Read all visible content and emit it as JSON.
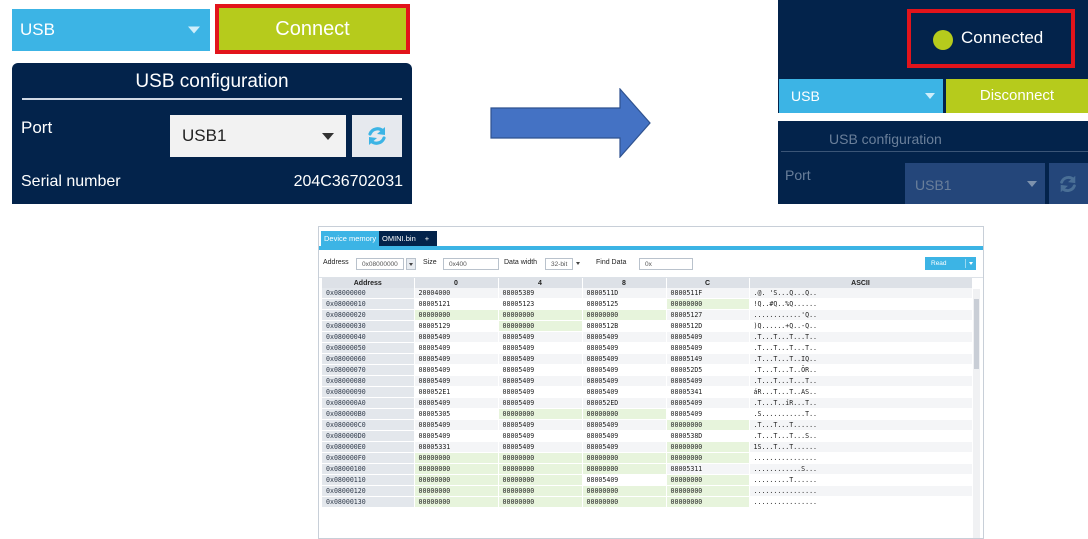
{
  "left_panel": {
    "interface": "USB",
    "connect_label": "Connect",
    "config_title": "USB configuration",
    "port_label": "Port",
    "port_value": "USB1",
    "serial_label": "Serial number",
    "serial_value": "204C36702031"
  },
  "right_panel": {
    "status": "Connected",
    "interface": "USB",
    "disconnect_label": "Disconnect",
    "config_title": "USB configuration",
    "port_label": "Port",
    "port_value": "USB1"
  },
  "colors": {
    "navy": "#03234b",
    "blue": "#3cb4e5",
    "green": "#b6cb1c",
    "highlight": "#e2141b",
    "arrow": "#4472c4"
  },
  "memory": {
    "tabs": [
      "Device memory",
      "OMINI.bin",
      "+"
    ],
    "toolbar": {
      "address_label": "Address",
      "address_value": "0x08000000",
      "size_label": "Size",
      "size_value": "0x400",
      "data_width_label": "Data width",
      "data_width_value": "32-bit",
      "find_label": "Find Data",
      "find_value": "0x",
      "read_label": "Read"
    },
    "columns": [
      "Address",
      "0",
      "4",
      "8",
      "C",
      "ASCII"
    ],
    "rows": [
      [
        "0x08000000",
        "20004000",
        "08005389",
        "0800511D",
        "0800511F",
        ".@. 'S...Q...Q.."
      ],
      [
        "0x08000010",
        "08005121",
        "08005123",
        "08005125",
        "00000000",
        "!Q..#Q..%Q......"
      ],
      [
        "0x08000020",
        "00000000",
        "00000000",
        "00000000",
        "08005127",
        "............'Q.."
      ],
      [
        "0x08000030",
        "08005129",
        "00000000",
        "0800512B",
        "0800512D",
        ")Q......+Q..-Q.."
      ],
      [
        "0x08000040",
        "08005409",
        "08005409",
        "08005409",
        "08005409",
        ".T...T...T...T.."
      ],
      [
        "0x08000050",
        "08005409",
        "08005409",
        "08005409",
        "08005409",
        ".T...T...T...T.."
      ],
      [
        "0x08000060",
        "08005409",
        "08005409",
        "08005409",
        "08005149",
        ".T...T...T..IQ.."
      ],
      [
        "0x08000070",
        "08005409",
        "08005409",
        "08005409",
        "080052D5",
        ".T...T...T..ÕR.."
      ],
      [
        "0x08000080",
        "08005409",
        "08005409",
        "08005409",
        "08005409",
        ".T...T...T...T.."
      ],
      [
        "0x08000090",
        "080052E1",
        "08005409",
        "08005409",
        "08005341",
        "áR...T...T..AS.."
      ],
      [
        "0x080000A0",
        "08005409",
        "08005409",
        "080052ED",
        "08005409",
        ".T...T..íR...T.."
      ],
      [
        "0x080000B0",
        "08005305",
        "00000000",
        "00000000",
        "08005409",
        ".S...........T.."
      ],
      [
        "0x080000C0",
        "08005409",
        "08005409",
        "08005409",
        "00000000",
        ".T...T...T......"
      ],
      [
        "0x080000D0",
        "08005409",
        "08005409",
        "08005409",
        "0800538D",
        ".T...T...T...S.."
      ],
      [
        "0x080000E0",
        "08005331",
        "08005409",
        "08005409",
        "00000000",
        "1S...T...T......"
      ],
      [
        "0x080000F0",
        "00000000",
        "00000000",
        "00000000",
        "00000000",
        "................"
      ],
      [
        "0x08000100",
        "00000000",
        "00000000",
        "00000000",
        "08005311",
        "............S..."
      ],
      [
        "0x08000110",
        "00000000",
        "00000000",
        "08005409",
        "00000000",
        ".........T......"
      ],
      [
        "0x08000120",
        "00000000",
        "00000000",
        "00000000",
        "00000000",
        "................"
      ],
      [
        "0x08000130",
        "00000000",
        "00000000",
        "00000000",
        "00000000",
        "................"
      ]
    ]
  }
}
